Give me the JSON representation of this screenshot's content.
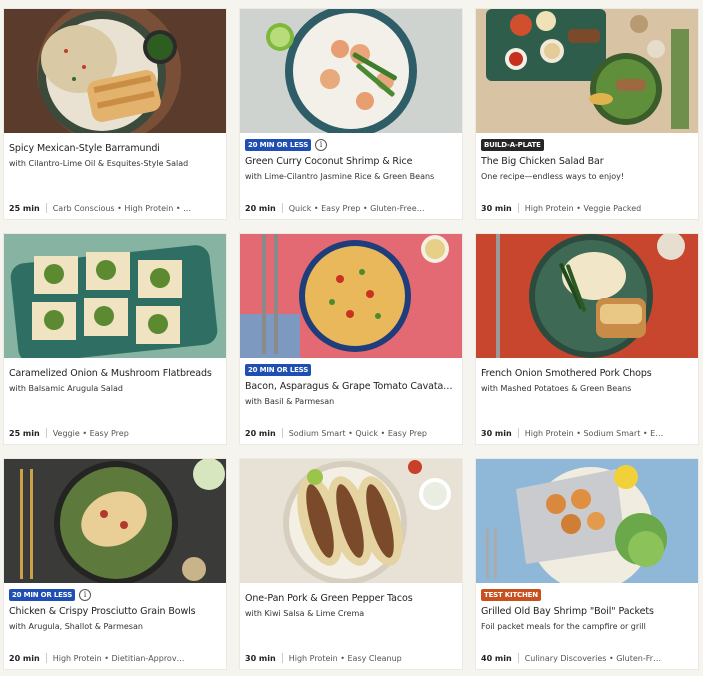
{
  "cards": [
    {
      "badge": "",
      "badge_color": "",
      "info": false,
      "title": "Spicy Mexican-Style Barramundi",
      "subtitle": "with Cilantro-Lime Oil & Esquites-Style Salad",
      "time": "25 min",
      "tags": "Carb Conscious • High Protein • …"
    },
    {
      "badge": "20 MIN OR LESS",
      "badge_color": "#1f4fb3",
      "info": true,
      "title": "Green Curry Coconut Shrimp & Rice",
      "subtitle": "with Lime-Cilantro Jasmine Rice & Green Beans",
      "time": "20 min",
      "tags": "Quick • Easy Prep • Gluten-Free…"
    },
    {
      "badge": "BUILD-A-PLATE",
      "badge_color": "#262626",
      "info": false,
      "title": "The Big Chicken Salad Bar",
      "subtitle": "One recipe—endless ways to enjoy!",
      "time": "30 min",
      "tags": "High Protein • Veggie Packed"
    },
    {
      "badge": "",
      "badge_color": "",
      "info": false,
      "title": "Caramelized Onion & Mushroom Flatbreads",
      "subtitle": "with Balsamic Arugula Salad",
      "time": "25 min",
      "tags": "Veggie • Easy Prep"
    },
    {
      "badge": "20 MIN OR LESS",
      "badge_color": "#1f4fb3",
      "info": false,
      "title": "Bacon, Asparagus & Grape Tomato Cavata…",
      "subtitle": "with Basil & Parmesan",
      "time": "20 min",
      "tags": "Sodium Smart • Quick • Easy Prep"
    },
    {
      "badge": "",
      "badge_color": "",
      "info": false,
      "title": "French Onion Smothered Pork Chops",
      "subtitle": "with Mashed Potatoes & Green Beans",
      "time": "30 min",
      "tags": "High Protein • Sodium Smart • E…"
    },
    {
      "badge": "20 MIN OR LESS",
      "badge_color": "#1f4fb3",
      "info": true,
      "title": "Chicken & Crispy Prosciutto Grain Bowls",
      "subtitle": "with Arugula, Shallot & Parmesan",
      "time": "20 min",
      "tags": "High Protein • Dietitian-Approv…"
    },
    {
      "badge": "",
      "badge_color": "",
      "info": false,
      "title": "One-Pan Pork & Green Pepper Tacos",
      "subtitle": "with Kiwi Salsa & Lime Crema",
      "time": "30 min",
      "tags": "High Protein • Easy Cleanup"
    },
    {
      "badge": "TEST KITCHEN",
      "badge_color": "#c8501e",
      "info": false,
      "title": "Grilled Old Bay Shrimp \"Boil\" Packets",
      "subtitle": "Foil packet meals for the campfire or grill",
      "time": "40 min",
      "tags": "Culinary Discoveries • Gluten-Fr…"
    }
  ]
}
